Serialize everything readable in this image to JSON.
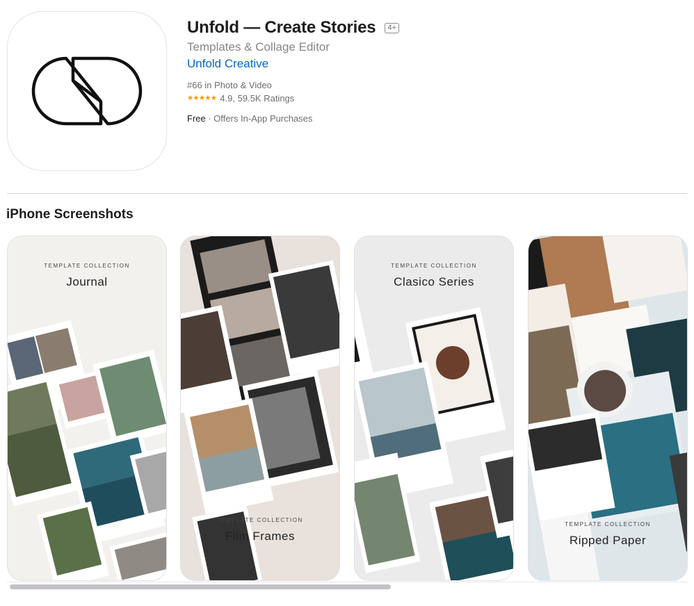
{
  "app": {
    "title": "Unfold — Create Stories",
    "age_rating": "4+",
    "subtitle": "Templates & Collage Editor",
    "developer": "Unfold Creative",
    "rank": "#66 in Photo & Video",
    "stars": "★★★★★",
    "rating_text": "4.9, 59.5K Ratings",
    "price": "Free",
    "separator": " · ",
    "iap": "Offers In-App Purchases",
    "icon": "unfold-logo-icon"
  },
  "screenshots_section": {
    "title": "iPhone Screenshots",
    "items": [
      {
        "caption": "TEMPLATE COLLECTION",
        "name": "Journal"
      },
      {
        "caption": "TEMPLATE COLLECTION",
        "name": "Film Frames"
      },
      {
        "caption": "TEMPLATE COLLECTION",
        "name": "Clasico Series"
      },
      {
        "caption": "TEMPLATE COLLECTION",
        "name": "Ripped Paper"
      }
    ]
  },
  "colors": {
    "accent_link": "#0066cc",
    "star": "#ff9500",
    "text_primary": "#1d1d1f",
    "text_secondary": "#86868b"
  }
}
